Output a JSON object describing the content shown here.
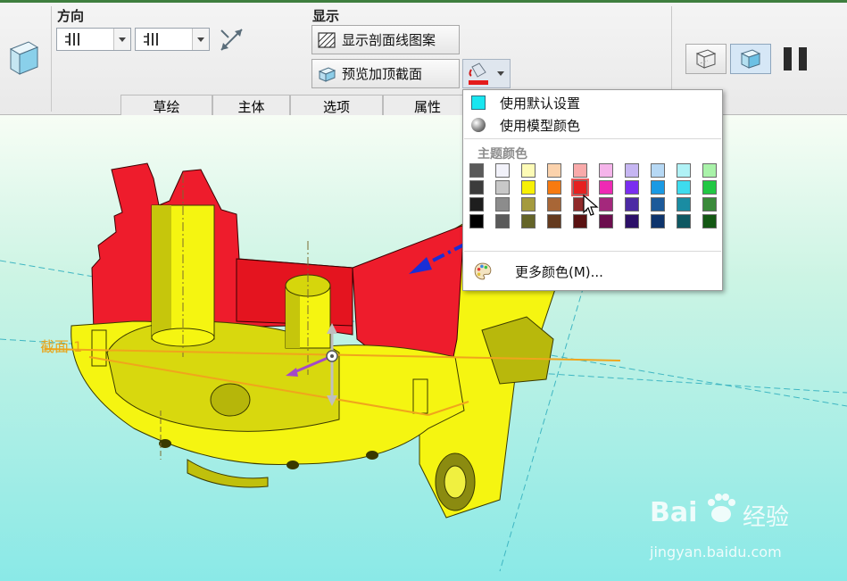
{
  "ribbon": {
    "direction_label": "方向",
    "display_label": "显示",
    "show_hatch_label": "显示剖面线图案",
    "preview_cap_label": "预览加顶截面",
    "tabs": [
      "草绘",
      "主体",
      "选项",
      "属性"
    ]
  },
  "color_menu": {
    "default_settings": "使用默认设置",
    "model_color": "使用模型颜色",
    "theme_colors_heading": "主题颜色",
    "more_colors": "更多颜色(M)...",
    "swatches": [
      [
        "#5a5a5a",
        "#f2f2fa",
        "#fdfbb6",
        "#fbd2ac",
        "#f9aaaa",
        "#f5b4ea",
        "#c6b6f2",
        "#b6d8f4",
        "#b0f2f6",
        "#a9f2a9"
      ],
      [
        "#3c3c3c",
        "#c8c8c8",
        "#f7f006",
        "#f77a10",
        "#e62020",
        "#ee2ab4",
        "#7a2ef0",
        "#1a9ae4",
        "#3edcee",
        "#22c844"
      ],
      [
        "#1e1e1e",
        "#8c8c8c",
        "#a49a3e",
        "#a86636",
        "#902a2a",
        "#a4287c",
        "#4c2aa4",
        "#1c5a9a",
        "#1a8ca2",
        "#3a8a3a"
      ],
      [
        "#000000",
        "#5a5a5a",
        "#646428",
        "#643a1e",
        "#5a1212",
        "#6c0e4e",
        "#2c1068",
        "#0e346c",
        "#0e5862",
        "#145814"
      ]
    ],
    "selected_swatch": "#e62020"
  },
  "viewport": {
    "section_label": "截面 1"
  },
  "watermark": {
    "brand": "Bai",
    "brand_cn": "经验",
    "url": "jingyan.baidu.com"
  },
  "colors": {
    "model_yellow": "#f5f511",
    "section_red": "#ee1c2c",
    "section_line": "#f0a51c",
    "accent_cyan": "#18e6f0"
  }
}
